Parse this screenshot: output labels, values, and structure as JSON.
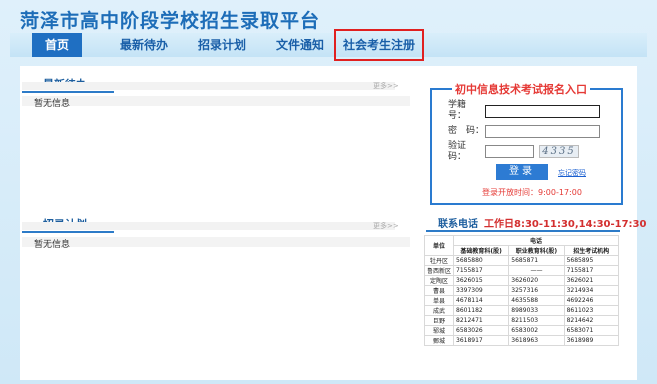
{
  "site": {
    "title": "菏泽市高中阶段学校招生录取平台"
  },
  "nav": {
    "items": [
      {
        "label": "首页"
      },
      {
        "label": "最新待办"
      },
      {
        "label": "招录计划"
      },
      {
        "label": "文件通知"
      },
      {
        "label": "社会考生注册"
      }
    ]
  },
  "todo": {
    "title": "最新待办",
    "more": "更多>>",
    "empty": "暂无信息"
  },
  "plan": {
    "title": "招录计划",
    "more": "更多>>",
    "empty": "暂无信息"
  },
  "login": {
    "title": "初中信息技术考试报名入口",
    "student_id_label": "学籍号：",
    "password_label": "密　码：",
    "captcha_label": "验证码：",
    "captcha_value": "4335",
    "submit": "登录",
    "forgot": "忘记密码",
    "hours": "登录开放时间：9:00-17:00"
  },
  "contact": {
    "title": "联系电话",
    "hours": "工作日8:30-11:30,14:30-17:30",
    "table": {
      "unit_header": "单位",
      "phone_header": "电话",
      "columns": [
        "基础教育科(股)",
        "职业教育科(股)",
        "招生考试机构"
      ],
      "rows": [
        [
          "牡丹区",
          "5685880",
          "5685871",
          "5685895"
        ],
        [
          "鲁西新区",
          "7155817",
          "——",
          "7155817"
        ],
        [
          "定陶区",
          "3626015",
          "3626020",
          "3626021"
        ],
        [
          "曹县",
          "3397309",
          "3257316",
          "3214934"
        ],
        [
          "单县",
          "4678114",
          "4635588",
          "4692246"
        ],
        [
          "成武",
          "8601182",
          "8989033",
          "8611023"
        ],
        [
          "巨野",
          "8212471",
          "8211503",
          "8214642"
        ],
        [
          "郓城",
          "6583026",
          "6583002",
          "6583071"
        ],
        [
          "鄄城",
          "3618917",
          "3618963",
          "3618989"
        ]
      ]
    }
  }
}
